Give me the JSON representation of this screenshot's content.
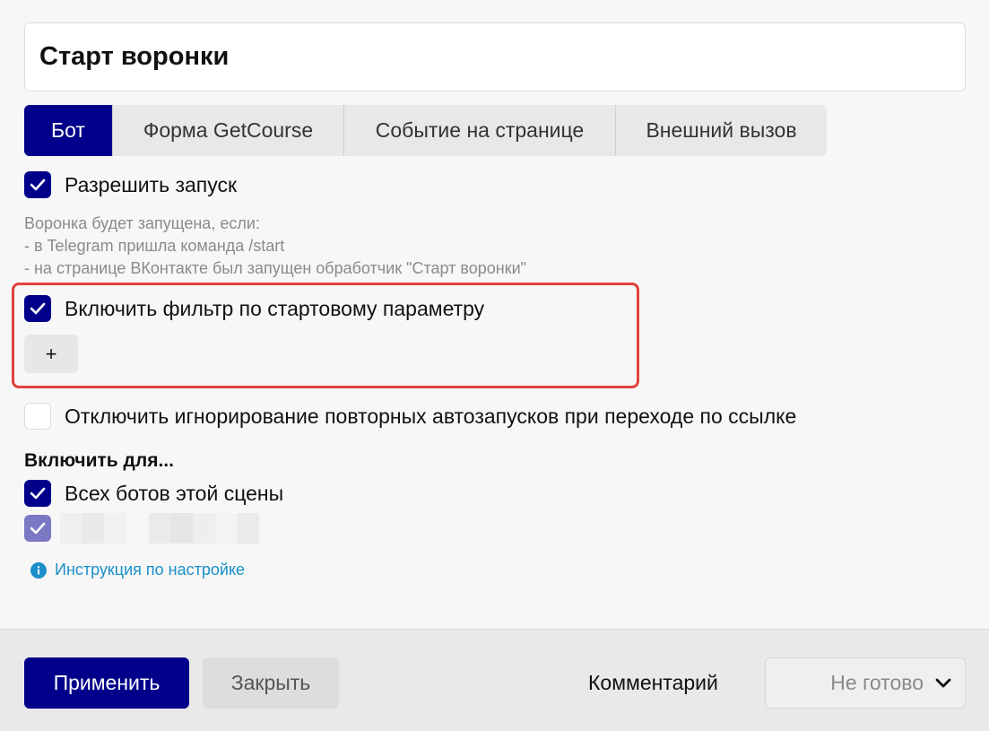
{
  "title": "Старт воронки",
  "tabs": [
    {
      "label": "Бот",
      "active": true
    },
    {
      "label": "Форма GetCourse",
      "active": false
    },
    {
      "label": "Событие на странице",
      "active": false
    },
    {
      "label": "Внешний вызов",
      "active": false
    }
  ],
  "allow_launch": {
    "label": "Разрешить запуск",
    "checked": true
  },
  "hint_lines": [
    "Воронка будет запущена, если:",
    "- в Telegram пришла команда /start",
    "- на странице ВКонтакте был запущен обработчик \"Старт воронки\""
  ],
  "start_filter": {
    "label": "Включить фильтр по стартовому параметру",
    "checked": true,
    "add_label": "+"
  },
  "disable_ignore": {
    "label": "Отключить игнорирование повторных автозапусков при переходе по ссылке",
    "checked": false
  },
  "enable_for": {
    "heading": "Включить для...",
    "all_bots": {
      "label": "Всех ботов этой сцены",
      "checked": true
    },
    "hidden_bot": {
      "checked": true
    }
  },
  "help_link": "Инструкция по настройке",
  "footer": {
    "apply": "Применить",
    "close": "Закрыть",
    "comment": "Комментарий",
    "status": "Не готово"
  },
  "colors": {
    "accent": "#02008a",
    "highlight_border": "#e0423a",
    "link": "#1a8fc9"
  },
  "icons": {
    "check": "check-icon",
    "info": "info-icon",
    "chevron": "chevron-down-icon"
  }
}
